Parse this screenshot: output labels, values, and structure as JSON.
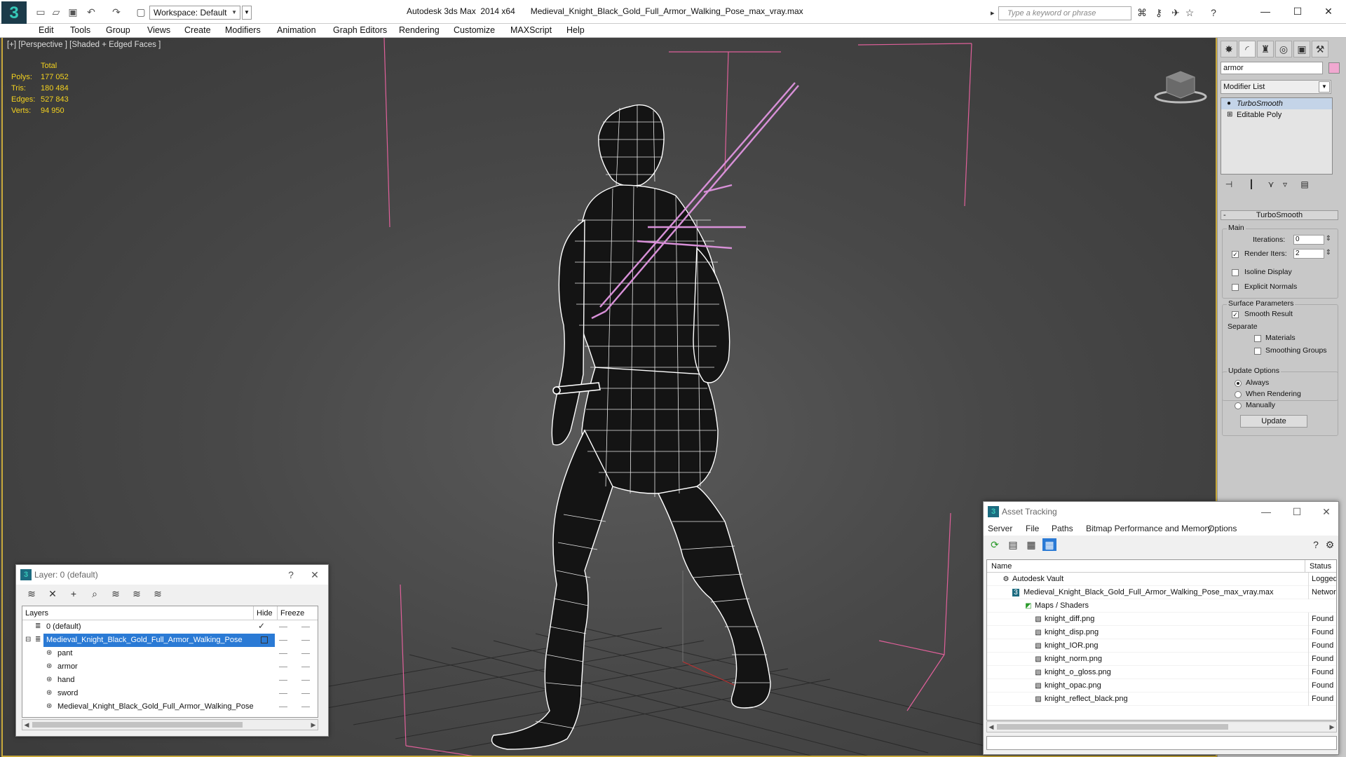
{
  "titlebar": {
    "app_name": "Autodesk 3ds Max  2014 x64",
    "file_name": "Medieval_Knight_Black_Gold_Full_Armor_Walking_Pose_max_vray.max",
    "workspace_label": "Workspace: Default",
    "search_placeholder": "Type a keyword or phrase",
    "logo_glyph": "3"
  },
  "menubar": {
    "items": [
      "Edit",
      "Tools",
      "Group",
      "Views",
      "Create",
      "Modifiers",
      "Animation",
      "Graph Editors",
      "Rendering",
      "Customize",
      "MAXScript",
      "Help"
    ]
  },
  "viewport": {
    "label": "[+] [Perspective ] [Shaded + Edged Faces ]",
    "stats_header": "Total",
    "stats": [
      {
        "key": "Polys:",
        "value": "177 052"
      },
      {
        "key": "Tris:",
        "value": "180 484"
      },
      {
        "key": "Edges:",
        "value": "527 843"
      },
      {
        "key": "Verts:",
        "value": "94 950"
      }
    ],
    "wire_color": "#ffffff",
    "sword_color": "#d890d8",
    "bbox_color": "#e0609a",
    "stats_color": "#f4d21f"
  },
  "command_panel": {
    "object_name": "armor",
    "object_color": "#f0a8d0",
    "modifier_list_label": "Modifier List",
    "stack": [
      "TurboSmooth",
      "Editable Poly"
    ],
    "rollout_title": "TurboSmooth",
    "main_group": "Main",
    "iterations_label": "Iterations:",
    "iterations_value": "0",
    "render_iters_label": "Render Iters:",
    "render_iters_value": "2",
    "isoline_label": "Isoline Display",
    "explicit_normals_label": "Explicit Normals",
    "surface_group": "Surface Parameters",
    "smooth_result_label": "Smooth Result",
    "separate_label": "Separate",
    "materials_label": "Materials",
    "smoothing_groups_label": "Smoothing Groups",
    "update_group": "Update Options",
    "always_label": "Always",
    "when_rendering_label": "When Rendering",
    "manually_label": "Manually",
    "update_button": "Update"
  },
  "layer_window": {
    "title": "Layer: 0 (default)",
    "col_layers": "Layers",
    "col_hide": "Hide",
    "col_freeze": "Freeze",
    "rows": [
      {
        "name": "0 (default)",
        "indent": 0
      },
      {
        "name": "Medieval_Knight_Black_Gold_Full_Armor_Walking_Pose",
        "indent": 0
      },
      {
        "name": "pant",
        "indent": 1
      },
      {
        "name": "armor",
        "indent": 1
      },
      {
        "name": "hand",
        "indent": 1
      },
      {
        "name": "sword",
        "indent": 1
      },
      {
        "name": "Medieval_Knight_Black_Gold_Full_Armor_Walking_Pose",
        "indent": 1
      }
    ]
  },
  "asset_window": {
    "title": "Asset Tracking",
    "menu": [
      "Server",
      "File",
      "Paths",
      "Bitmap Performance and Memory",
      "Options"
    ],
    "col_name": "Name",
    "col_status": "Status",
    "rows": [
      {
        "name": "Autodesk Vault",
        "status": "Logged C",
        "indent": 0
      },
      {
        "name": "Medieval_Knight_Black_Gold_Full_Armor_Walking_Pose_max_vray.max",
        "status": "Network",
        "indent": 1
      },
      {
        "name": "Maps / Shaders",
        "status": "",
        "indent": 2
      },
      {
        "name": "knight_diff.png",
        "status": "Found",
        "indent": 3
      },
      {
        "name": "knight_disp.png",
        "status": "Found",
        "indent": 3
      },
      {
        "name": "knight_IOR.png",
        "status": "Found",
        "indent": 3
      },
      {
        "name": "knight_norm.png",
        "status": "Found",
        "indent": 3
      },
      {
        "name": "knight_o_gloss.png",
        "status": "Found",
        "indent": 3
      },
      {
        "name": "knight_opac.png",
        "status": "Found",
        "indent": 3
      },
      {
        "name": "knight_reflect_black.png",
        "status": "Found",
        "indent": 3
      }
    ]
  }
}
